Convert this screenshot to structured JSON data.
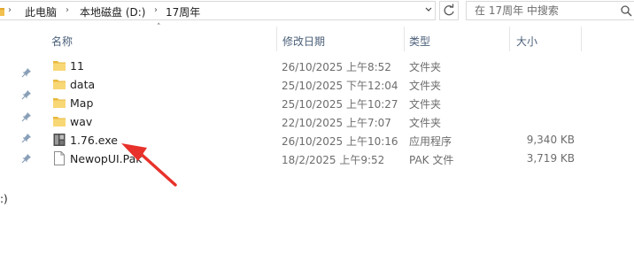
{
  "address": {
    "breadcrumbs": [
      "此电脑",
      "本地磁盘 (D:)",
      "17周年"
    ],
    "dropdown_icon": "chevron-down-icon"
  },
  "search": {
    "placeholder": "在 17周年 中搜索"
  },
  "columns": {
    "name": "名称",
    "date": "修改日期",
    "type": "类型",
    "size": "大小"
  },
  "files": [
    {
      "name": "11",
      "date": "26/10/2025 上午8:52",
      "type": "文件夹",
      "size": "",
      "icon": "folder-icon"
    },
    {
      "name": "data",
      "date": "25/10/2025 下午12:04",
      "type": "文件夹",
      "size": "",
      "icon": "folder-icon"
    },
    {
      "name": "Map",
      "date": "25/10/2025 上午10:27",
      "type": "文件夹",
      "size": "",
      "icon": "folder-icon"
    },
    {
      "name": "wav",
      "date": "22/10/2025 上午7:07",
      "type": "文件夹",
      "size": "",
      "icon": "folder-icon"
    },
    {
      "name": "1.76.exe",
      "date": "26/10/2025 上午10:16",
      "type": "应用程序",
      "size": "9,340 KB",
      "icon": "application-icon"
    },
    {
      "name": "NewopUI.Pak",
      "date": "18/2/2025 上午9:52",
      "type": "PAK 文件",
      "size": "3,719 KB",
      "icon": "file-icon"
    }
  ],
  "nav_pane": {
    "clipped_text": ":)"
  },
  "annotation": {
    "color": "#e8312b"
  }
}
